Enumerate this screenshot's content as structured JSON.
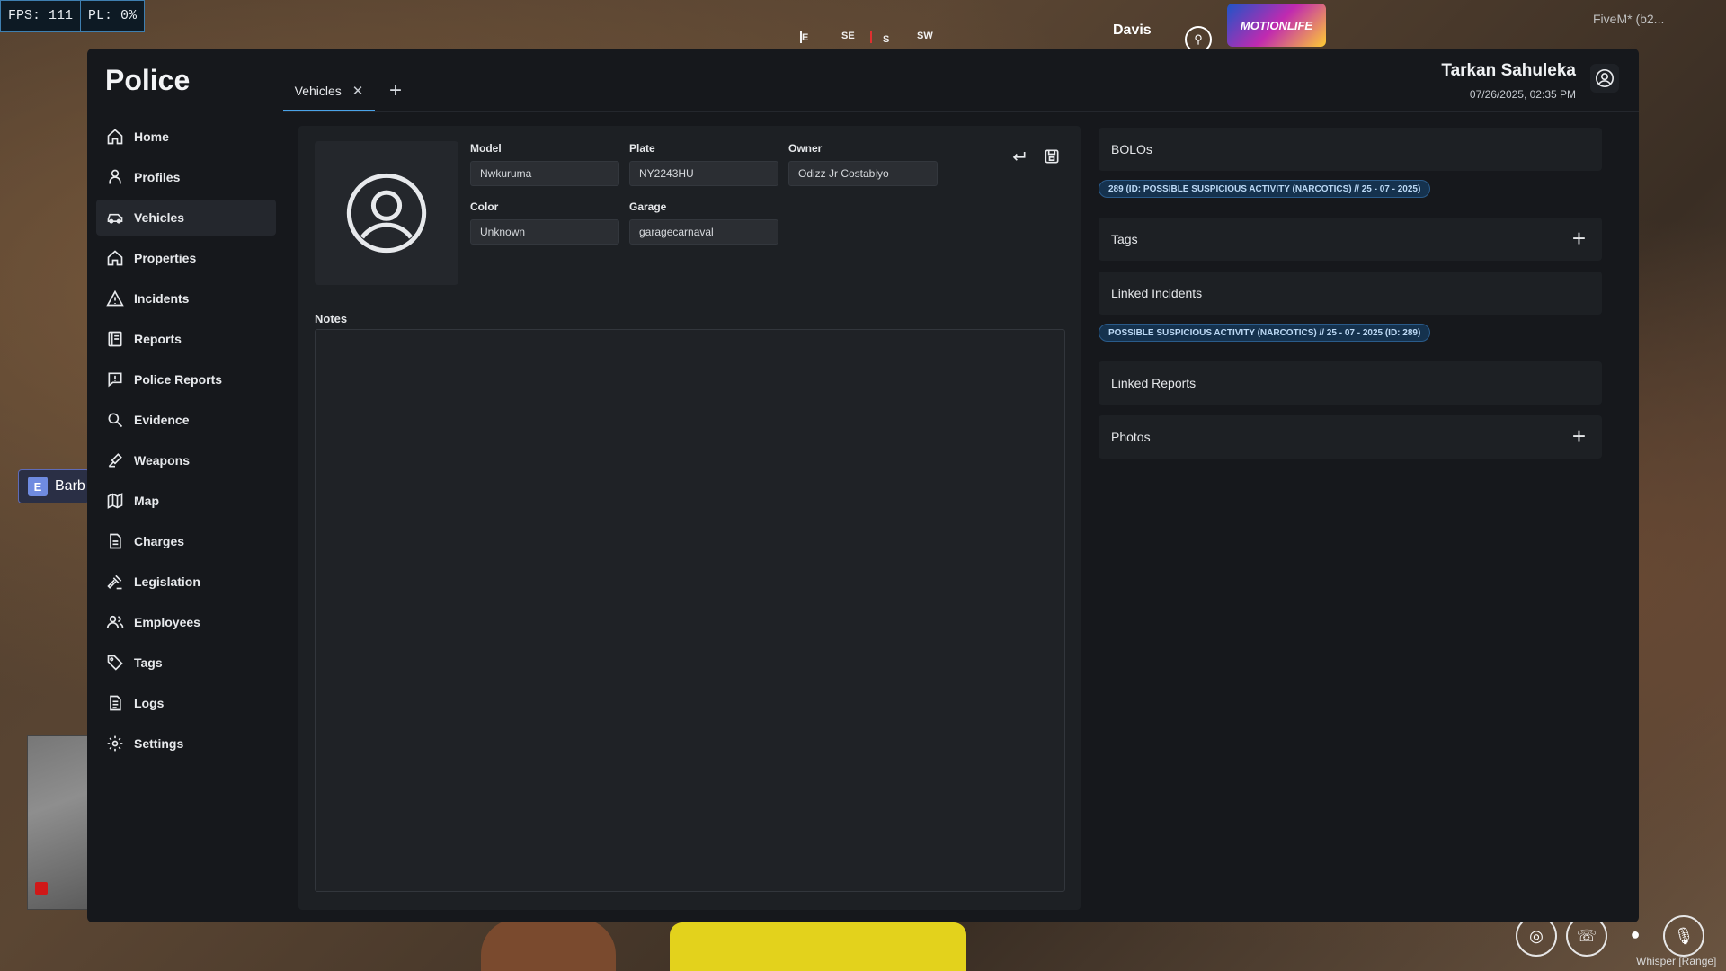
{
  "hud": {
    "fps": "FPS: 111",
    "pl": "PL: 0%",
    "compass": [
      "E",
      "SE",
      "S",
      "SW"
    ],
    "street": "Davis",
    "brand": "MOTIONLIFE",
    "client": "FiveM* (b2...",
    "interact_key": "E",
    "interact_text": "Barb",
    "voice_mode": "Whisper [Range]"
  },
  "app": {
    "title": "Police"
  },
  "nav": [
    {
      "label": "Home",
      "icon": "home-icon"
    },
    {
      "label": "Profiles",
      "icon": "user-icon"
    },
    {
      "label": "Vehicles",
      "icon": "car-icon",
      "active": true
    },
    {
      "label": "Properties",
      "icon": "house-icon"
    },
    {
      "label": "Incidents",
      "icon": "warning-icon"
    },
    {
      "label": "Reports",
      "icon": "report-icon"
    },
    {
      "label": "Police Reports",
      "icon": "chat-report-icon"
    },
    {
      "label": "Evidence",
      "icon": "search-icon"
    },
    {
      "label": "Weapons",
      "icon": "weapon-icon"
    },
    {
      "label": "Map",
      "icon": "map-icon"
    },
    {
      "label": "Charges",
      "icon": "document-icon"
    },
    {
      "label": "Legislation",
      "icon": "gavel-icon"
    },
    {
      "label": "Employees",
      "icon": "users-icon"
    },
    {
      "label": "Tags",
      "icon": "tag-icon"
    },
    {
      "label": "Logs",
      "icon": "log-icon"
    },
    {
      "label": "Settings",
      "icon": "gear-icon"
    }
  ],
  "tabs": [
    {
      "label": "Vehicles"
    }
  ],
  "user": {
    "name": "Tarkan Sahuleka",
    "datetime": "07/26/2025, 02:35 PM"
  },
  "vehicle": {
    "model_label": "Model",
    "model": "Nwkuruma",
    "plate_label": "Plate",
    "plate": "NY2243HU",
    "owner_label": "Owner",
    "owner": "Odizz Jr Costabiyo",
    "color_label": "Color",
    "color": "Unknown",
    "garage_label": "Garage",
    "garage": "garagecarnaval",
    "notes_label": "Notes",
    "notes": ""
  },
  "right": {
    "bolos_title": "BOLOs",
    "bolo_chip": "289 (ID: POSSIBLE SUSPICIOUS ACTIVITY (NARCOTICS) // 25 - 07 - 2025)",
    "tags_title": "Tags",
    "linked_incidents_title": "Linked Incidents",
    "incident_chip": "POSSIBLE SUSPICIOUS ACTIVITY (NARCOTICS) // 25 - 07 - 2025 (ID: 289)",
    "linked_reports_title": "Linked Reports",
    "photos_title": "Photos"
  },
  "colors": {
    "accent": "#4aa3e8",
    "panel": "#1d2024",
    "window": "#16181c",
    "chip_bg": "#15324e"
  }
}
